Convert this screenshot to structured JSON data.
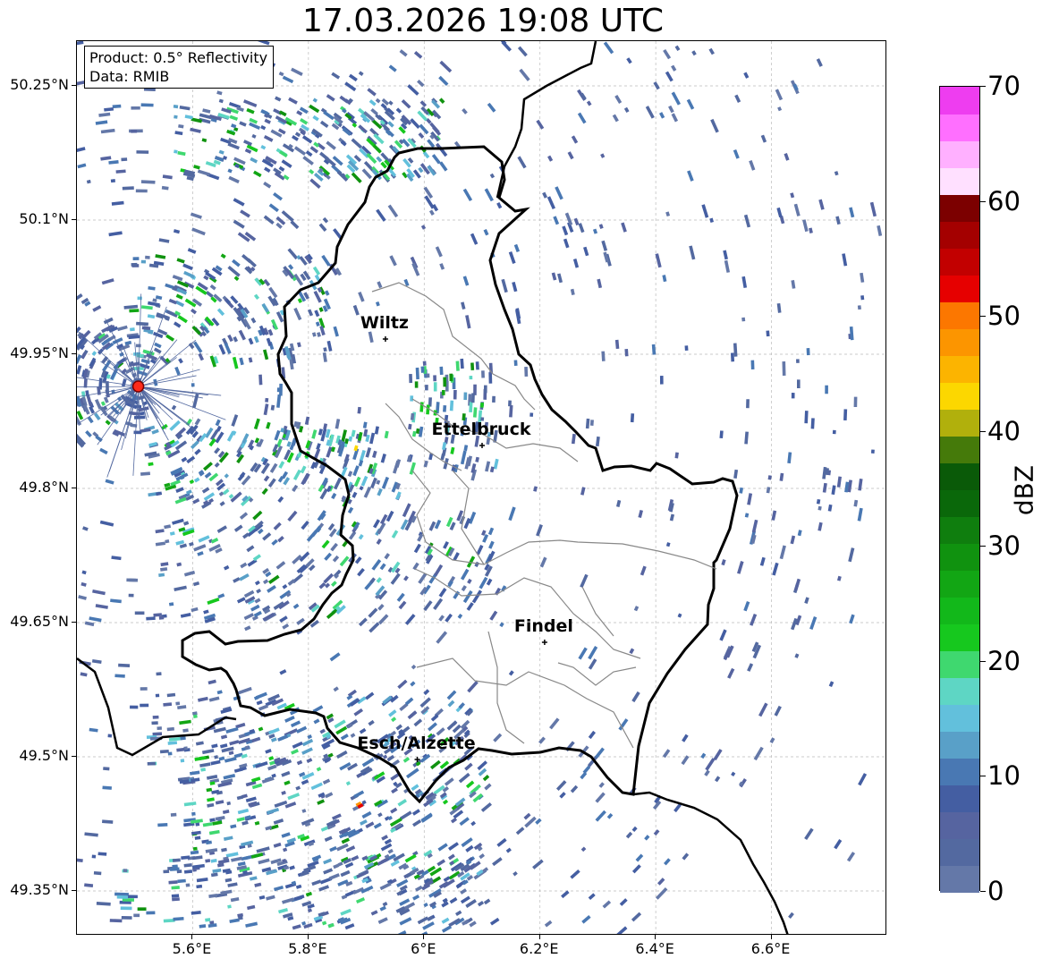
{
  "title": "17.03.2026 19:08 UTC",
  "info": {
    "product": "Product: 0.5° Reflectivity",
    "data": "Data: RMIB"
  },
  "map": {
    "lon_range": [
      5.4,
      6.8
    ],
    "lat_range": [
      49.3,
      50.3
    ],
    "lat_ticks": [
      {
        "value": 50.25,
        "label": "50.25°N"
      },
      {
        "value": 50.1,
        "label": "50.1°N"
      },
      {
        "value": 49.95,
        "label": "49.95°N"
      },
      {
        "value": 49.8,
        "label": "49.8°N"
      },
      {
        "value": 49.65,
        "label": "49.65°N"
      },
      {
        "value": 49.5,
        "label": "49.5°N"
      },
      {
        "value": 49.35,
        "label": "49.35°N"
      }
    ],
    "lon_ticks": [
      {
        "value": 5.6,
        "label": "5.6°E"
      },
      {
        "value": 5.8,
        "label": "5.8°E"
      },
      {
        "value": 6.0,
        "label": "6°E"
      },
      {
        "value": 6.2,
        "label": "6.2°E"
      },
      {
        "value": 6.4,
        "label": "6.4°E"
      },
      {
        "value": 6.6,
        "label": "6.6°E"
      }
    ],
    "radar_site": {
      "lon": 5.506,
      "lat": 49.914,
      "color": "#ff2b1a"
    },
    "cities": [
      {
        "name": "Wiltz",
        "lon": 5.933,
        "lat": 49.967
      },
      {
        "name": "Ettelbruck",
        "lon": 6.1,
        "lat": 49.848
      },
      {
        "name": "Findel",
        "lon": 6.208,
        "lat": 49.628
      },
      {
        "name": "Esch/Alzette",
        "lon": 5.988,
        "lat": 49.497
      }
    ]
  },
  "colorbar": {
    "unit": "dBZ",
    "min": 0,
    "max": 70,
    "ticks": [
      "0",
      "10",
      "20",
      "30",
      "40",
      "50",
      "60",
      "70"
    ],
    "colors": [
      "#6478a8",
      "#5369a0",
      "#5664a0",
      "#445ea2",
      "#4978b3",
      "#59a0c8",
      "#62c0dc",
      "#5ed6c4",
      "#3fd86f",
      "#16c81e",
      "#12b81a",
      "#12a614",
      "#10920f",
      "#0f7e0e",
      "#0a680a",
      "#0a5a08",
      "#457a0a",
      "#b1b00c",
      "#fcd700",
      "#fcb400",
      "#fc9500",
      "#fc7700",
      "#e60000",
      "#c20000",
      "#a40000",
      "#7c0000",
      "#ffe0ff",
      "#ffb0ff",
      "#ff6fff",
      "#ee3df0"
    ]
  }
}
